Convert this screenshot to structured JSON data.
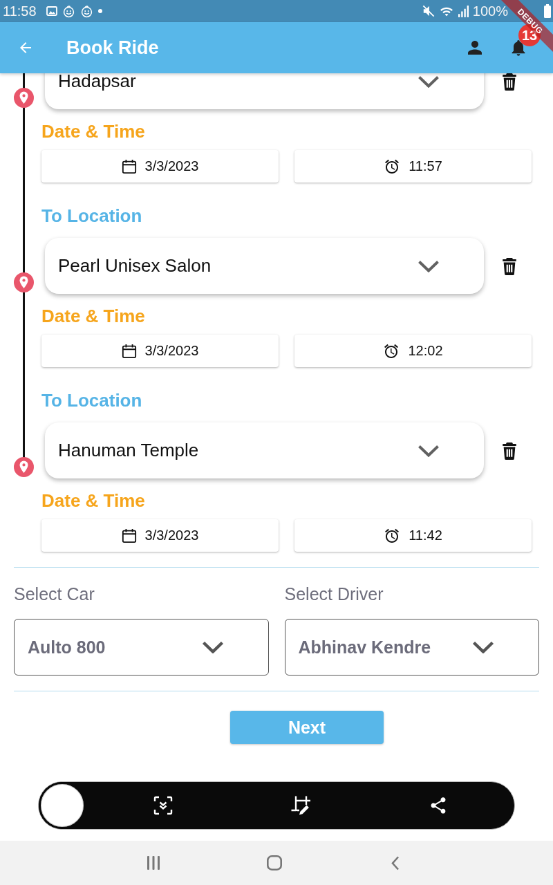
{
  "status_bar": {
    "time": "11:58",
    "battery": "100%"
  },
  "debug_banner": {
    "label": "DEBUG"
  },
  "app_bar": {
    "title": "Book Ride",
    "notification_count": "13"
  },
  "stops": [
    {
      "location": "Hadapsar",
      "date_time_label": "Date & Time",
      "date": "3/3/2023",
      "time": "11:57"
    },
    {
      "heading": "To Location",
      "location": "Pearl Unisex Salon",
      "date_time_label": "Date & Time",
      "date": "3/3/2023",
      "time": "12:02"
    },
    {
      "heading": "To Location",
      "location": "Hanuman Temple",
      "date_time_label": "Date & Time",
      "date": "3/3/2023",
      "time": "11:42"
    }
  ],
  "selects": [
    {
      "label": "Select Car",
      "value": "Aulto 800"
    },
    {
      "label": "Select Driver",
      "value": "Abhinav Kendre"
    }
  ],
  "next_button": {
    "label": "Next"
  }
}
